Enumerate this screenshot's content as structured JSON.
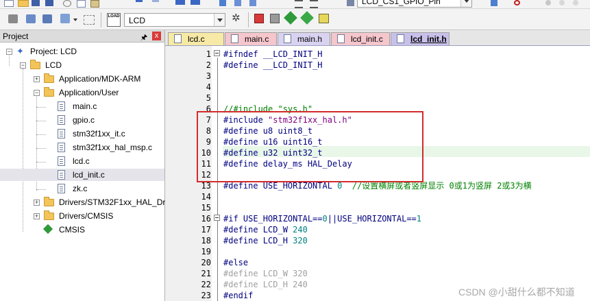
{
  "toolbar": {
    "target_combo": "LCD",
    "config_combo": "LCD_CS1_GPIO_Pin"
  },
  "project_panel": {
    "title": "Project",
    "pin_icon": "pin-icon",
    "close_label": "x",
    "tree": {
      "root": "Project: LCD",
      "target": "LCD",
      "groups": {
        "mdk_arm": "Application/MDK-ARM",
        "user": "Application/User",
        "drivers_hal": "Drivers/STM32F1xx_HAL_Driv",
        "drivers_cmsis": "Drivers/CMSIS",
        "cmsis": "CMSIS"
      },
      "user_files": [
        "main.c",
        "gpio.c",
        "stm32f1xx_it.c",
        "stm32f1xx_hal_msp.c",
        "lcd.c",
        "lcd_init.c",
        "zk.c"
      ]
    }
  },
  "tabs": [
    {
      "label": "lcd.c",
      "color": "#f7e9a6",
      "active": false
    },
    {
      "label": "main.c",
      "color": "#f5c6cc",
      "active": false
    },
    {
      "label": "main.h",
      "color": "#d9d2f0",
      "active": false
    },
    {
      "label": "lcd_init.c",
      "color": "#f5c6cc",
      "active": false
    },
    {
      "label": "lcd_init.h",
      "color": "#c9c0ea",
      "active": true
    }
  ],
  "editor": {
    "line_numbers": [
      "1",
      "2",
      "3",
      "4",
      "5",
      "6",
      "7",
      "8",
      "9",
      "10",
      "11",
      "12",
      "13",
      "14",
      "15",
      "16",
      "17",
      "18",
      "19",
      "20",
      "21",
      "22",
      "23"
    ],
    "lines": {
      "l1": "#ifndef __LCD_INIT_H",
      "l2": "#define __LCD_INIT_H",
      "l6": "//#include \"sys.h\"",
      "l7a": "#include ",
      "l7b": "\"stm32f1xx_hal.h\"",
      "l8": "#define u8 uint8_t",
      "l9": "#define u16 uint16_t",
      "l10": "#define u32 uint32_t",
      "l11": "#define delay_ms HAL_Delay",
      "l13a": "#define USE_HORIZONTAL ",
      "l13b": "0",
      "l13c": "  //设置横屏或者竖屏显示 0或1为竖屏 2或3为横",
      "l16a": "#if USE_HORIZONTAL==",
      "l16b": "0",
      "l16c": "||USE_HORIZONTAL==",
      "l16d": "1",
      "l17a": "#define LCD_W ",
      "l17b": "240",
      "l18a": "#define LCD_H ",
      "l18b": "320",
      "l20": "#else",
      "l21": "#define LCD_W 320",
      "l22": "#define LCD_H 240",
      "l23": "#endif"
    }
  },
  "watermark": "CSDN @小甜什么都不知道",
  "colors": {
    "highlight_box": "#d22b2b",
    "current_line": "#e8f7e8"
  }
}
